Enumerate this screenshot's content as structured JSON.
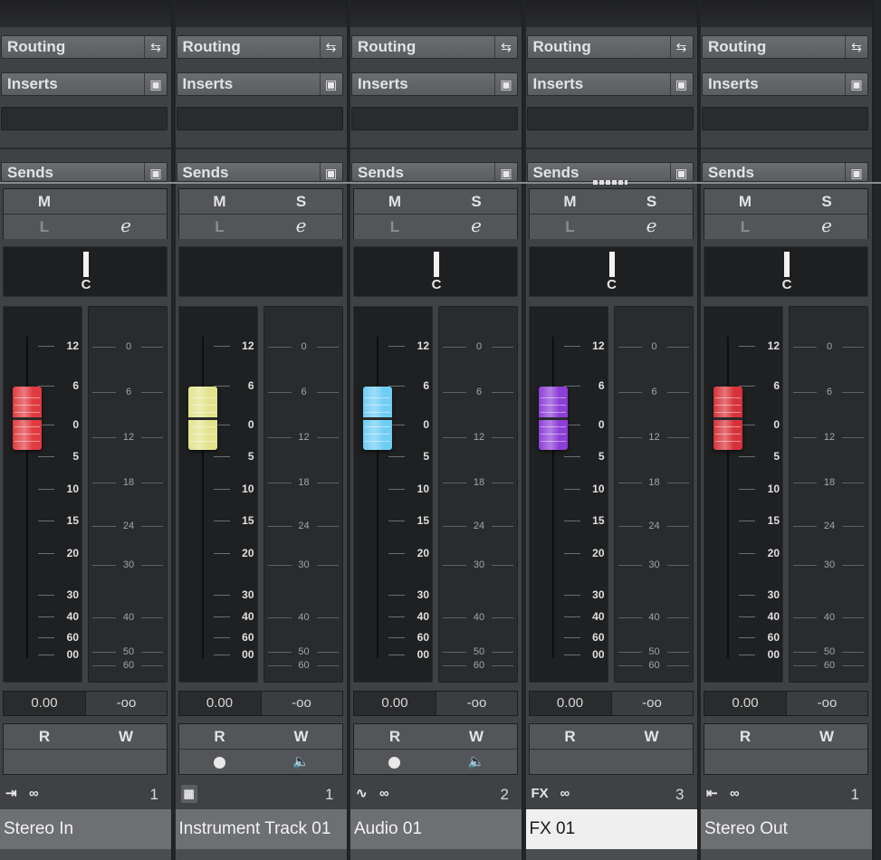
{
  "labels": {
    "routing": "Routing",
    "inserts": "Inserts",
    "sends": "Sends",
    "mute": "M",
    "solo": "S",
    "listen": "L",
    "edit": "e",
    "read": "R",
    "write": "W",
    "pan_center": "C"
  },
  "scales": {
    "fader": [
      "12",
      "6",
      "0",
      "5",
      "10",
      "15",
      "20",
      "30",
      "40",
      "60",
      "00"
    ],
    "meter": [
      "0",
      "6",
      "12",
      "18",
      "24",
      "30",
      "40",
      "50",
      "60"
    ]
  },
  "channels": [
    {
      "name": "Stereo In",
      "number": "1",
      "type_icon": "input-icon",
      "icon_glyph": "⇥",
      "volume": "0.00",
      "peak": "-oo",
      "fader_color": "#e03a40",
      "has_solo": false,
      "has_pan": true,
      "has_monitor_controls": false,
      "selected": false
    },
    {
      "name": "Instrument Track 01",
      "number": "1",
      "type_icon": "piano-keyboard-icon",
      "icon_glyph": "▦",
      "volume": "0.00",
      "peak": "-oo",
      "fader_color": "#e3e38e",
      "has_solo": true,
      "has_pan": false,
      "has_monitor_controls": true,
      "selected": false
    },
    {
      "name": "Audio 01",
      "number": "2",
      "type_icon": "audio-waveform-icon",
      "icon_glyph": "∿",
      "volume": "0.00",
      "peak": "-oo",
      "fader_color": "#6ecdf5",
      "has_solo": true,
      "has_pan": true,
      "has_monitor_controls": true,
      "selected": false
    },
    {
      "name": "FX 01",
      "number": "3",
      "type_icon": "fx-icon",
      "icon_glyph": "FX",
      "volume": "0.00",
      "peak": "-oo",
      "fader_color": "#8d3ed8",
      "has_solo": true,
      "has_pan": true,
      "has_monitor_controls": false,
      "selected": true
    },
    {
      "name": "Stereo Out",
      "number": "1",
      "type_icon": "output-icon",
      "icon_glyph": "⇤",
      "volume": "0.00",
      "peak": "-oo",
      "fader_color": "#d7323a",
      "has_solo": true,
      "has_pan": true,
      "has_monitor_controls": false,
      "selected": false
    }
  ]
}
